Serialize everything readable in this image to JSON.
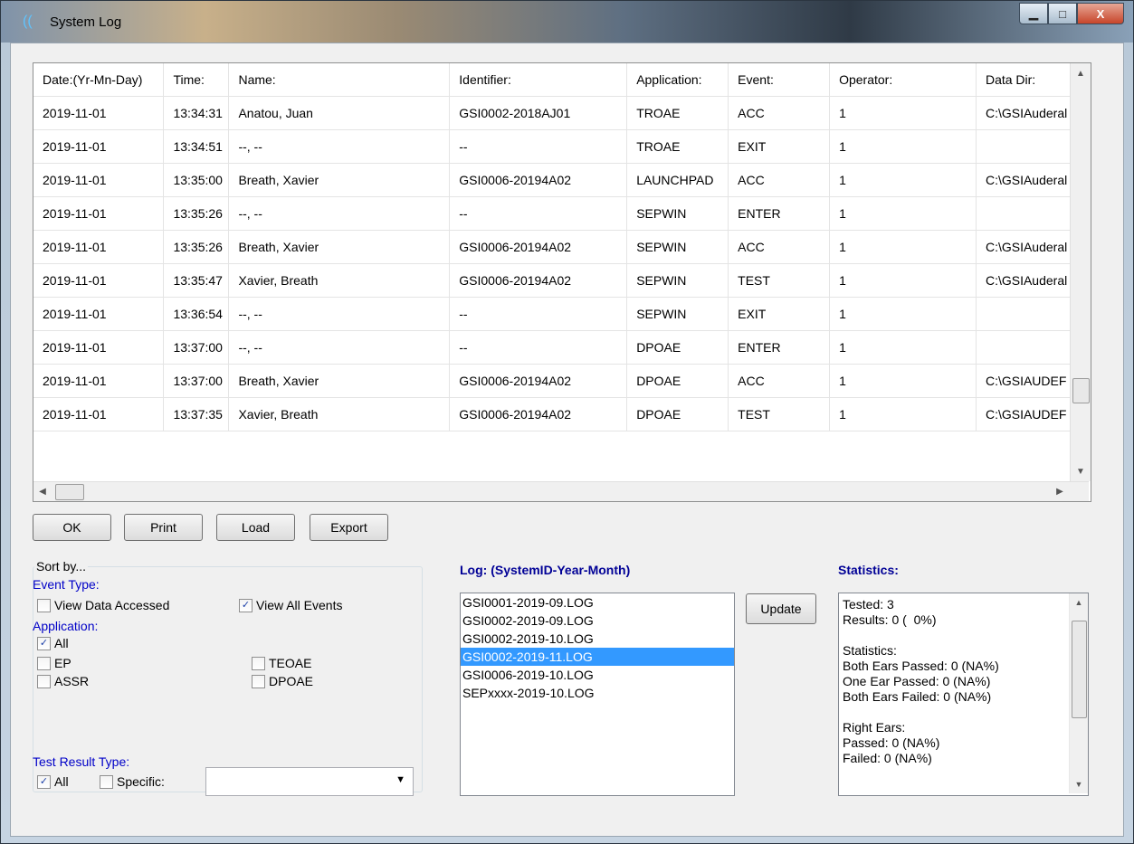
{
  "window": {
    "title": "System Log",
    "min_glyph": "▁",
    "max_glyph": "□",
    "close_glyph": "X"
  },
  "grid": {
    "columns": [
      "Date:(Yr-Mn-Day)",
      "Time:",
      "Name:",
      "Identifier:",
      "Application:",
      "Event:",
      "Operator:",
      "Data Dir:"
    ],
    "rows": [
      [
        "2019-11-01",
        "13:34:31",
        "Anatou, Juan",
        "GSI0002-2018AJ01",
        "TROAE",
        "ACC",
        "1",
        "C:\\GSIAuderal"
      ],
      [
        "2019-11-01",
        "13:34:51",
        "--, --",
        "--",
        "TROAE",
        "EXIT",
        "1",
        ""
      ],
      [
        "2019-11-01",
        "13:35:00",
        "Breath, Xavier",
        "GSI0006-20194A02",
        "LAUNCHPAD",
        "ACC",
        "1",
        "C:\\GSIAuderal"
      ],
      [
        "2019-11-01",
        "13:35:26",
        "--, --",
        "--",
        "SEPWIN",
        "ENTER",
        "1",
        ""
      ],
      [
        "2019-11-01",
        "13:35:26",
        "Breath, Xavier",
        "GSI0006-20194A02",
        "SEPWIN",
        "ACC",
        "1",
        "C:\\GSIAuderal"
      ],
      [
        "2019-11-01",
        "13:35:47",
        "Xavier, Breath",
        "GSI0006-20194A02",
        "SEPWIN",
        "TEST",
        "1",
        "C:\\GSIAuderal"
      ],
      [
        "2019-11-01",
        "13:36:54",
        "--, --",
        "--",
        "SEPWIN",
        "EXIT",
        "1",
        ""
      ],
      [
        "2019-11-01",
        "13:37:00",
        "--, --",
        "--",
        "DPOAE",
        "ENTER",
        "1",
        ""
      ],
      [
        "2019-11-01",
        "13:37:00",
        "Breath, Xavier",
        "GSI0006-20194A02",
        "DPOAE",
        "ACC",
        "1",
        "C:\\GSIAUDEF"
      ],
      [
        "2019-11-01",
        "13:37:35",
        "Xavier, Breath",
        "GSI0006-20194A02",
        "DPOAE",
        "TEST",
        "1",
        "C:\\GSIAUDEF"
      ]
    ],
    "scroll_up": "▲",
    "scroll_down": "▼",
    "scroll_left": "◀",
    "scroll_right": "▶"
  },
  "buttons": {
    "ok": "OK",
    "print": "Print",
    "load": "Load",
    "export": "Export",
    "update": "Update"
  },
  "sort": {
    "legend": "Sort by...",
    "event_type_label": "Event Type:",
    "view_data_accessed": {
      "label": "View Data Accessed",
      "checked": false
    },
    "view_all_events": {
      "label": "View All Events",
      "checked": true
    },
    "application_label": "Application:",
    "app_all": {
      "label": "All",
      "checked": true
    },
    "app_ep": {
      "label": "EP",
      "checked": false
    },
    "app_teoae": {
      "label": "TEOAE",
      "checked": false
    },
    "app_assr": {
      "label": "ASSR",
      "checked": false
    },
    "app_dpoae": {
      "label": "DPOAE",
      "checked": false
    },
    "test_result_label": "Test Result Type:",
    "result_all": {
      "label": "All",
      "checked": true
    },
    "result_specific": {
      "label": "Specific:",
      "checked": false
    },
    "combo_value": "",
    "combo_arrow": "▼",
    "check_glyph": "✓"
  },
  "log": {
    "heading": "Log: (SystemID-Year-Month)",
    "items": [
      "GSI0001-2019-09.LOG",
      "GSI0002-2019-09.LOG",
      "GSI0002-2019-10.LOG",
      "GSI0002-2019-11.LOG",
      "GSI0006-2019-10.LOG",
      "SEPxxxx-2019-10.LOG"
    ],
    "selected_index": 3
  },
  "statistics": {
    "heading": "Statistics:",
    "text": "Tested: 3\nResults: 0 (  0%)\n\nStatistics:\nBoth Ears Passed: 0 (NA%)\nOne Ear Passed: 0 (NA%)\nBoth Ears Failed: 0 (NA%)\n\nRight Ears:\nPassed: 0 (NA%)\nFailed: 0 (NA%)",
    "scroll_up": "▲",
    "scroll_down": "▼"
  },
  "colors": {
    "selection": "#3399ff",
    "label_blue": "#0000c8",
    "heading_blue": "#000096"
  }
}
